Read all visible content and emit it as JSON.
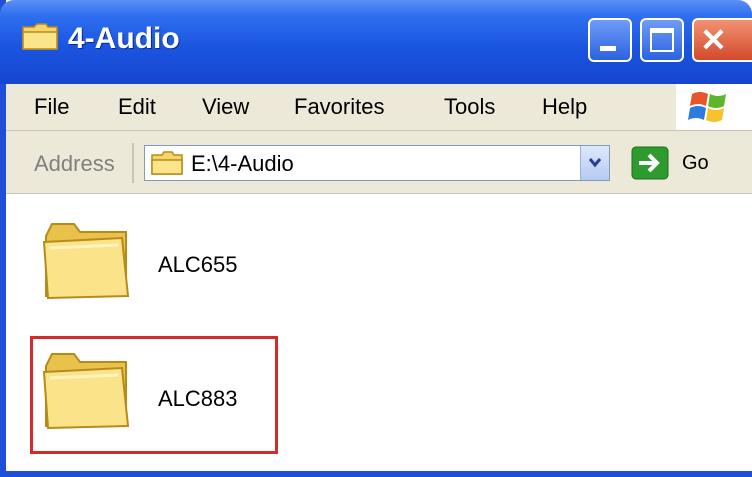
{
  "window": {
    "title": "4-Audio",
    "buttons": {
      "minimize": "minimize",
      "maximize": "maximize",
      "close": "close"
    }
  },
  "menu": {
    "items": [
      "File",
      "Edit",
      "View",
      "Favorites",
      "Tools",
      "Help"
    ]
  },
  "address": {
    "label": "Address",
    "value": "E:\\4-Audio",
    "go_label": "Go"
  },
  "folders": [
    {
      "name": "ALC655",
      "highlighted": false
    },
    {
      "name": "ALC883",
      "highlighted": true
    }
  ],
  "colors": {
    "titlebar": "#1a55e0",
    "highlight_border": "#d42a2a",
    "close_button": "#d24a2a",
    "go_arrow": "#2e9b2e",
    "folder": "#f5d56a"
  },
  "icons": {
    "title": "folder-icon",
    "address": "folder-icon",
    "go": "go-arrow-icon",
    "dropdown": "chevron-down-icon",
    "brand": "windows-logo-icon"
  }
}
